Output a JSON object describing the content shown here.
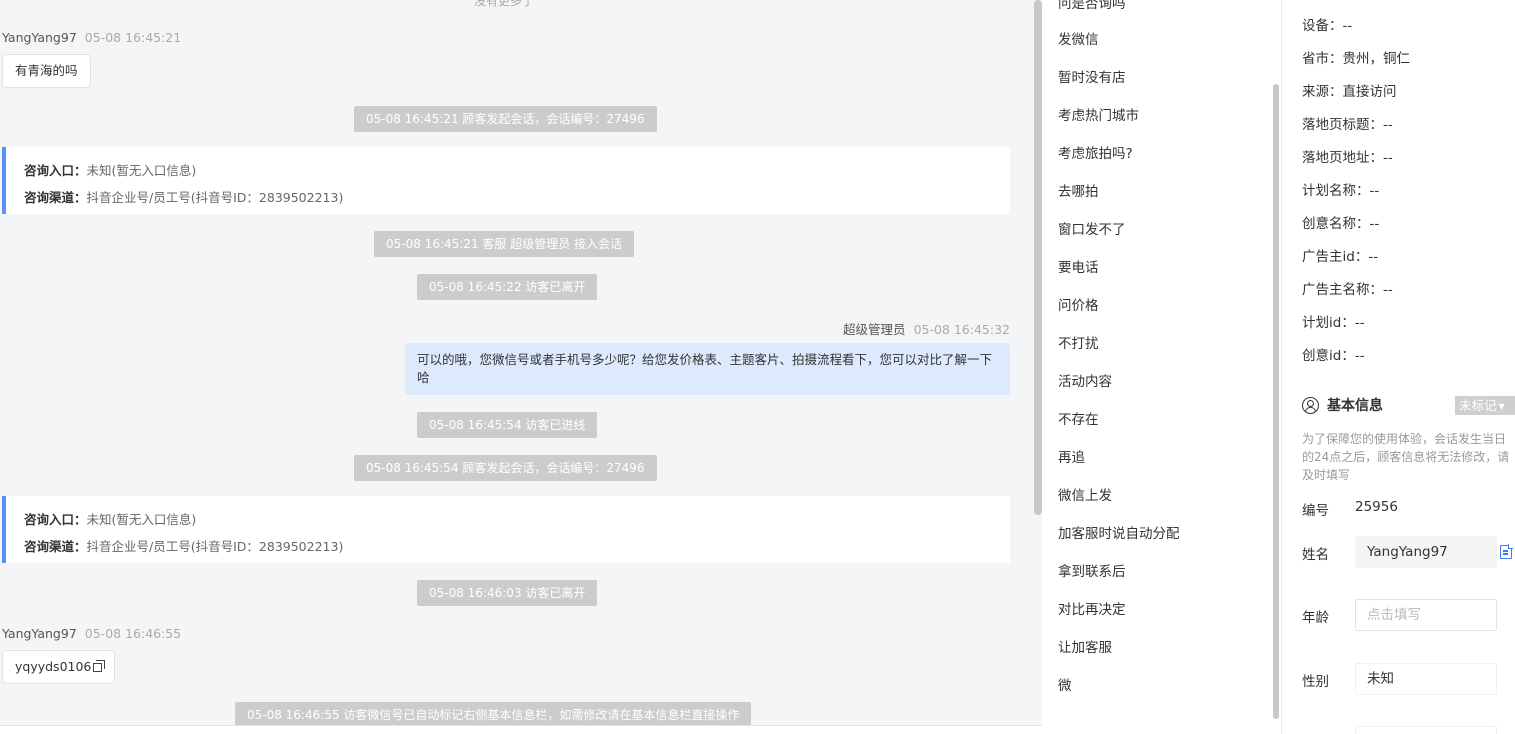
{
  "chat": {
    "no_more": "没有更多了",
    "messages": [
      {
        "type": "visitor",
        "sender": "YangYang97",
        "time": "05-08 16:45:21",
        "text": "有青海的吗"
      },
      {
        "type": "system",
        "text": "05-08 16:45:21 顾客发起会话，会话编号：27496"
      },
      {
        "type": "card",
        "entry_label": "咨询入口：",
        "entry_value": "未知(暂无入口信息)",
        "channel_label": "咨询渠道：",
        "channel_value": "抖音企业号/员工号(抖音号ID：2839502213)"
      },
      {
        "type": "system",
        "text": "05-08 16:45:21 客服 超级管理员 接入会话"
      },
      {
        "type": "system",
        "text": "05-08 16:45:22 访客已离开"
      },
      {
        "type": "agent",
        "sender": "超级管理员",
        "time": "05-08 16:45:32",
        "text": "可以的哦，您微信号或者手机号多少呢？给您发价格表、主题客片、拍摄流程看下，您可以对比了解一下哈"
      },
      {
        "type": "system",
        "text": "05-08 16:45:54 访客已进线"
      },
      {
        "type": "system",
        "text": "05-08 16:45:54 顾客发起会话，会话编号：27496"
      },
      {
        "type": "card",
        "entry_label": "咨询入口：",
        "entry_value": "未知(暂无入口信息)",
        "channel_label": "咨询渠道：",
        "channel_value": "抖音企业号/员工号(抖音号ID：2839502213)"
      },
      {
        "type": "system",
        "text": "05-08 16:46:03 访客已离开"
      },
      {
        "type": "visitor",
        "sender": "YangYang97",
        "time": "05-08 16:46:55",
        "text": "yqyyds0106"
      },
      {
        "type": "system",
        "text": "05-08 16:46:55 访客微信号已自动标记右侧基本信息栏，如需修改请在基本信息栏直接操作"
      }
    ]
  },
  "quick_replies": {
    "items": [
      "问是否询吗",
      "发微信",
      "暂时没有店",
      "考虑热门城市",
      "考虑旅拍吗?",
      "去哪拍",
      "窗口发不了",
      "要电话",
      "问价格",
      "不打扰",
      "活动内容",
      "不存在",
      "再追",
      "微信上发",
      "加客服时说自动分配",
      "拿到联系后",
      "对比再决定",
      "让加客服",
      "微"
    ]
  },
  "info": {
    "attributes": [
      {
        "label": "设备：",
        "value": "--"
      },
      {
        "label": "省市：",
        "value": "贵州，铜仁"
      },
      {
        "label": "来源：",
        "value": "直接访问"
      },
      {
        "label": "落地页标题：",
        "value": "--"
      },
      {
        "label": "落地页地址：",
        "value": "--"
      },
      {
        "label": "计划名称：",
        "value": "--"
      },
      {
        "label": "创意名称：",
        "value": "--"
      },
      {
        "label": "广告主id：",
        "value": "--"
      },
      {
        "label": "广告主名称：",
        "value": "--"
      },
      {
        "label": "计划id：",
        "value": "--"
      },
      {
        "label": "创意id：",
        "value": "--"
      }
    ],
    "basic": {
      "title": "基本信息",
      "tag_select": "未标记",
      "notice": "为了保障您的使用体验，会话发生当日的24点之后，顾客信息将无法修改，请及时填写",
      "id_label": "编号",
      "id_value": "25956",
      "name_label": "姓名",
      "name_value": "YangYang97",
      "age_label": "年龄",
      "age_placeholder": "点击填写",
      "gender_label": "性别",
      "gender_value": "未知"
    }
  }
}
